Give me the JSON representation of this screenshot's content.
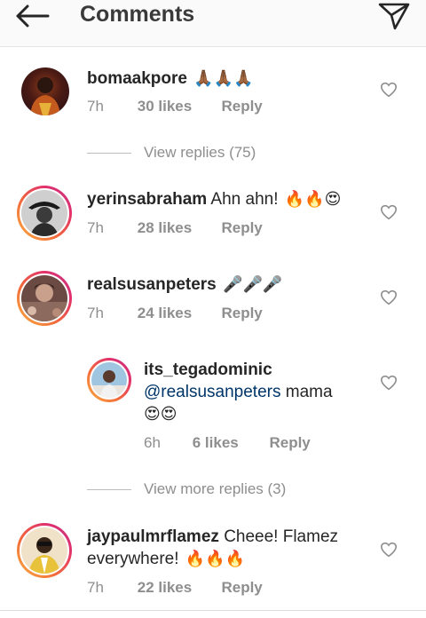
{
  "header": {
    "title": "Comments",
    "back_icon": "arrow-left-icon",
    "send_icon": "paper-plane-icon"
  },
  "comments": [
    {
      "username": "bomaakpore",
      "text": "",
      "emojis": "🙏🏾🙏🏾🙏🏾",
      "time": "7h",
      "likes": "30 likes",
      "reply_label": "Reply",
      "view_replies": "View replies (75)"
    },
    {
      "username": "yerinsabraham",
      "text": "Ahn ahn!",
      "emojis": "🔥🔥😍",
      "time": "7h",
      "likes": "28 likes",
      "reply_label": "Reply"
    },
    {
      "username": "realsusanpeters",
      "text": "",
      "emojis": "🎤🎤🎤",
      "time": "7h",
      "likes": "24 likes",
      "reply_label": "Reply",
      "replies": [
        {
          "username": "its_tegadominic",
          "mention": "@realsusanpeters",
          "text": "mama",
          "emojis": "😍😍",
          "time": "6h",
          "likes": "6 likes",
          "reply_label": "Reply"
        }
      ],
      "view_replies": "View more replies (3)"
    },
    {
      "username": "jaypaulmrflamez",
      "text": "Cheee! Flamez everywhere!",
      "emojis": "🔥🔥🔥",
      "time": "7h",
      "likes": "22 likes",
      "reply_label": "Reply"
    }
  ]
}
